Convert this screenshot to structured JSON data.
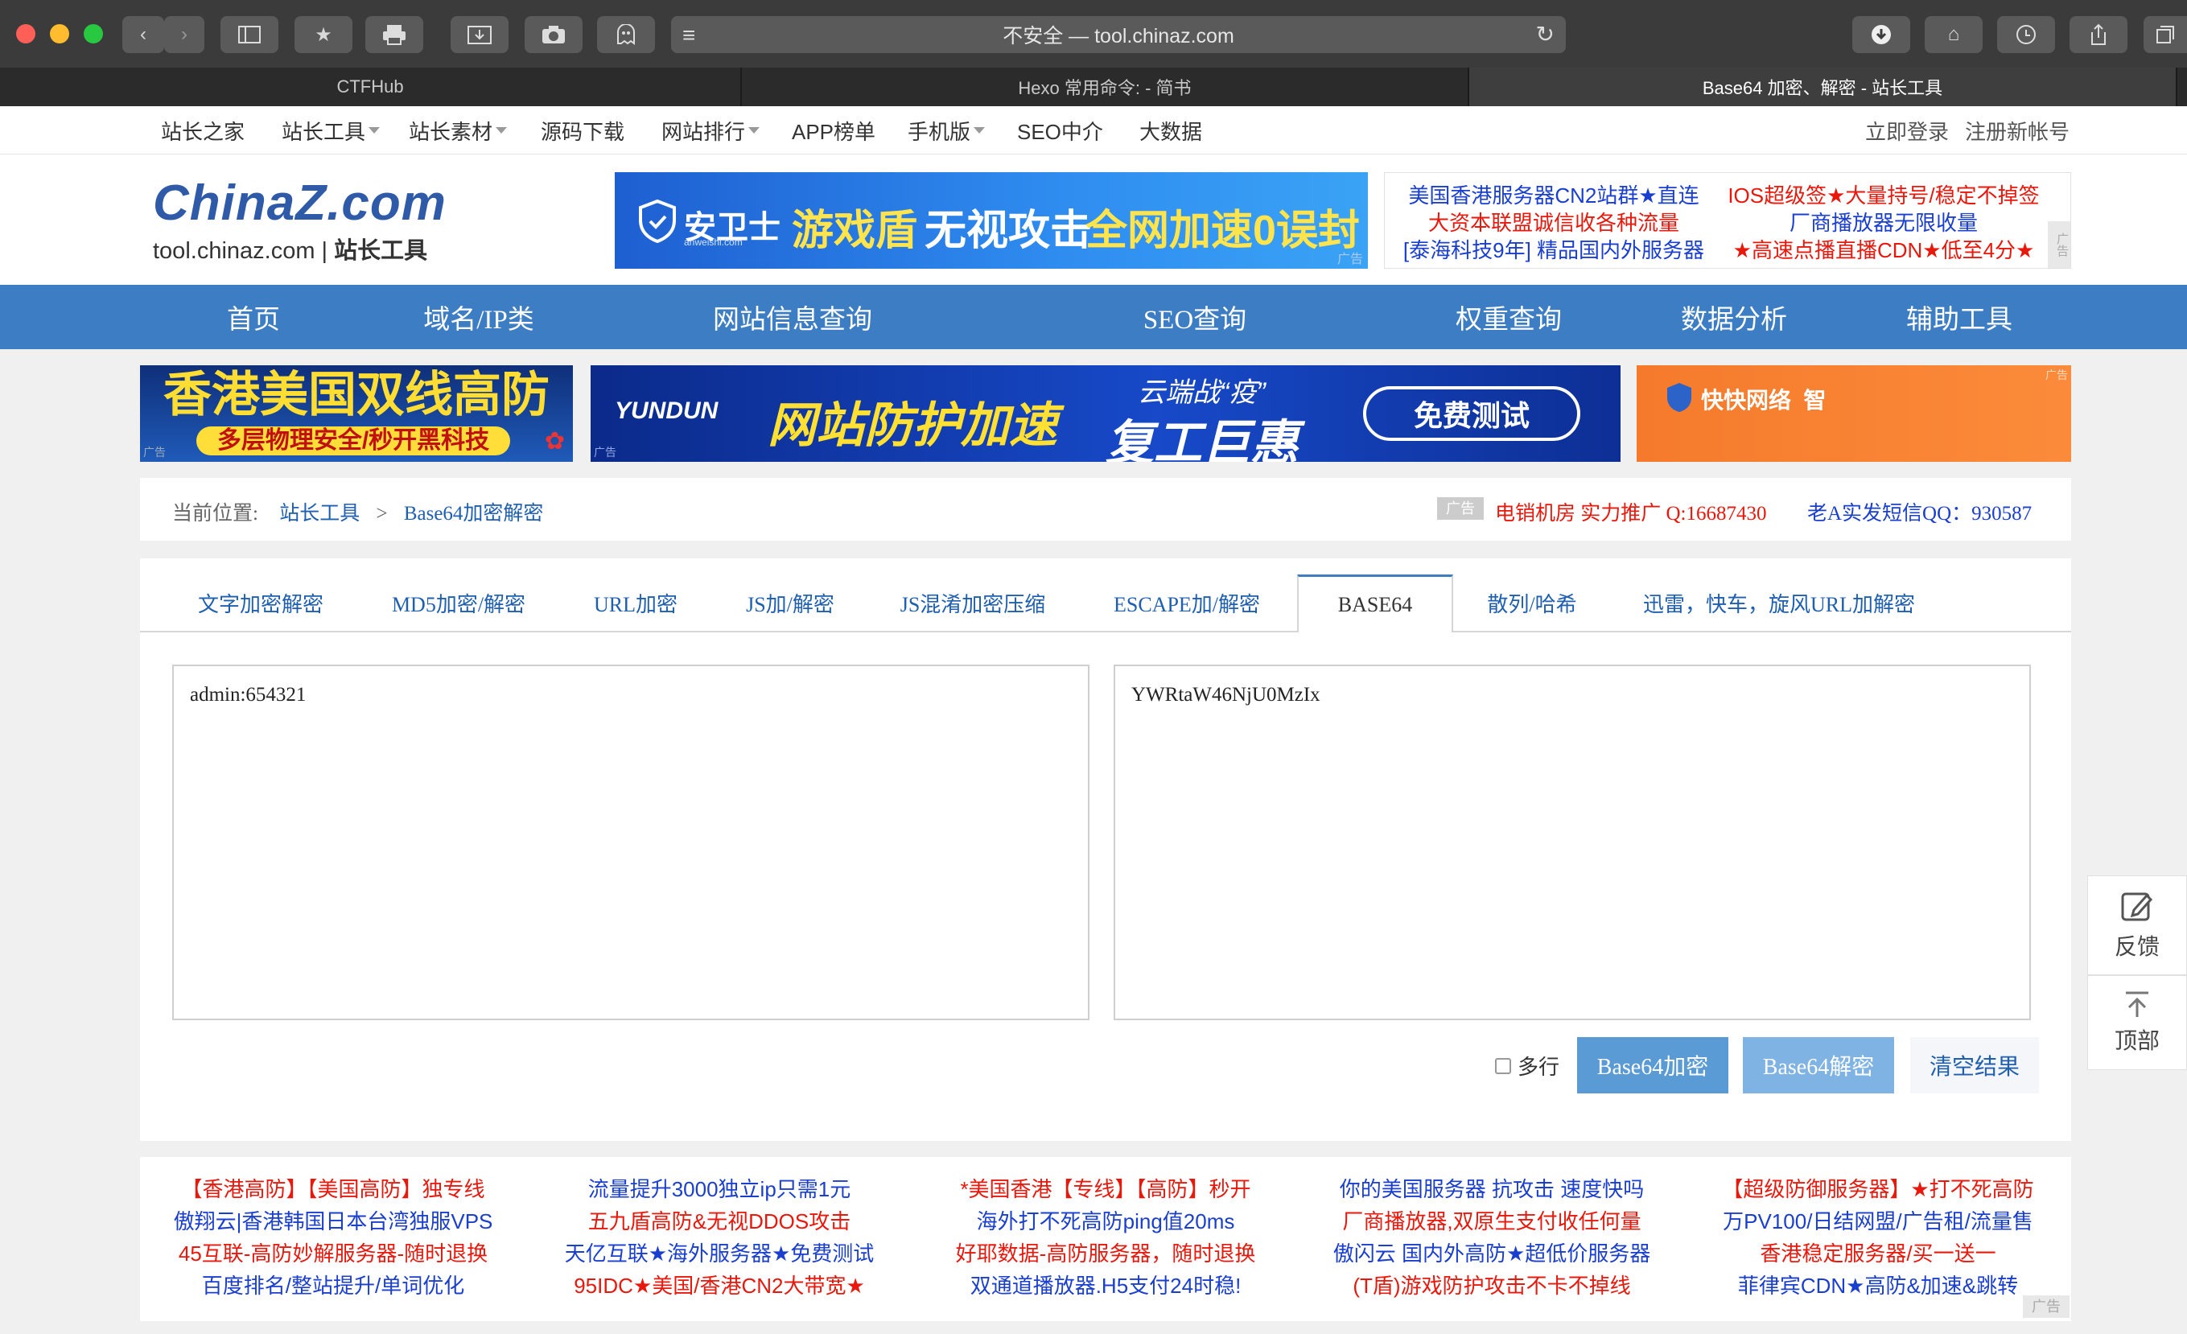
{
  "browser": {
    "address": "不安全 — tool.chinaz.com",
    "tabs": [
      "CTFHub",
      "Hexo 常用命令: - 简书",
      "Base64 加密、解密 - 站长工具"
    ]
  },
  "topnav": {
    "items": [
      "站长之家",
      "站长工具",
      "站长素材",
      "源码下载",
      "网站排行",
      "APP榜单",
      "手机版",
      "SEO中介",
      "大数据"
    ],
    "login": "立即登录",
    "register": "注册新帐号"
  },
  "logo": {
    "brand_a": "China",
    "brand_b": "Z",
    "brand_c": ".com",
    "sub": "tool.chinaz.com",
    "sub2": "站长工具"
  },
  "header_ad": {
    "brand": "安卫士",
    "brand_sub": "anweishi.com",
    "slogan_a": "游戏盾",
    "slogan_b": "无视攻击",
    "slogan_c": "全网加速0误封",
    "tag": "广告"
  },
  "text_ads": [
    [
      "美国香港服务器CN2站群★直连",
      "IOS超级签★大量持号/稳定不掉签"
    ],
    [
      "大资本联盟诚信收各种流量",
      "厂商播放器无限收量"
    ],
    [
      "[泰海科技9年] 精品国内外服务器",
      "★高速点播直播CDN★低至4分★"
    ]
  ],
  "mainnav": [
    "首页",
    "域名/IP类",
    "网站信息查询",
    "SEO查询",
    "权重查询",
    "数据分析",
    "辅助工具"
  ],
  "banners": {
    "b1_top": "香港美国双线高防",
    "b1_bottom": "多层物理安全/秒开黑科技",
    "b2_brand": "YUNDUN",
    "b2_text": "网站防护加速",
    "b2_sub1": "云端战“疫”",
    "b2_sub2": "复工巨惠",
    "b2_btn": "免费测试",
    "b3_text": "快快网络  智",
    "ad": "广告"
  },
  "breadcrumb": {
    "label": "当前位置:",
    "home": "站长工具",
    "sep": ">",
    "current": "Base64加密解密",
    "ad_tag": "广告",
    "ad1": "电销机房 实力推广 Q:16687430",
    "ad2": "老A实发短信QQ：930587"
  },
  "tool_tabs": [
    "文字加密解密",
    "MD5加密/解密",
    "URL加密",
    "JS加/解密",
    "JS混淆加密压缩",
    "ESCAPE加/解密",
    "BASE64",
    "散列/哈希",
    "迅雷，快车，旋风URL加解密"
  ],
  "input_text": "admin:654321",
  "output_text": "YWRtaW46NjU0MzIx",
  "controls": {
    "multiline": "多行",
    "encode": "Base64加密",
    "decode": "Base64解密",
    "clear": "清空结果"
  },
  "side": {
    "feedback": "反馈",
    "top": "顶部"
  },
  "footer_ads": [
    [
      {
        "t": "【香港高防】【美国高防】独专线",
        "c": "red"
      },
      {
        "t": "傲翔云|香港韩国日本台湾独服VPS",
        "c": "blue"
      },
      {
        "t": "45互联-高防妙解服务器-随时退换",
        "c": "red"
      },
      {
        "t": "百度排名/整站提升/单词优化",
        "c": "blue"
      }
    ],
    [
      {
        "t": "流量提升3000独立ip只需1元",
        "c": "blue"
      },
      {
        "t": "五九盾高防&无视DDOS攻击",
        "c": "red"
      },
      {
        "t": "天亿互联★海外服务器★免费测试",
        "c": "blue"
      },
      {
        "t": "95IDC★美国/香港CN2大带宽★",
        "c": "red"
      }
    ],
    [
      {
        "t": "*美国香港【专线】【高防】秒开",
        "c": "red"
      },
      {
        "t": "海外打不死高防ping值20ms",
        "c": "blue"
      },
      {
        "t": "好耶数据-高防服务器，随时退换",
        "c": "red"
      },
      {
        "t": "双通道播放器.H5支付24时稳!",
        "c": "blue"
      }
    ],
    [
      {
        "t": "你的美国服务器 抗攻击 速度快吗",
        "c": "blue"
      },
      {
        "t": "厂商播放器,双原生支付收任何量",
        "c": "red"
      },
      {
        "t": "傲闪云 国内外高防★超低价服务器",
        "c": "blue"
      },
      {
        "t": "(T盾)游戏防护攻击不卡不掉线",
        "c": "red"
      }
    ],
    [
      {
        "t": "【超级防御服务器】★打不死高防",
        "c": "red"
      },
      {
        "t": "万PV100/日结网盟/广告租/流量售",
        "c": "blue"
      },
      {
        "t": "香港稳定服务器/买一送一",
        "c": "red"
      },
      {
        "t": "菲律宾CDN★高防&加速&跳转",
        "c": "blue"
      }
    ]
  ],
  "footer_ad_tag": "广告",
  "colors": {
    "nav_blue": "#3d7dc4",
    "link_blue": "#1f5fb0",
    "ad_red": "#e8180c",
    "button_blue": "#5b9bd5",
    "button_blue_light": "#7fb3e3"
  }
}
